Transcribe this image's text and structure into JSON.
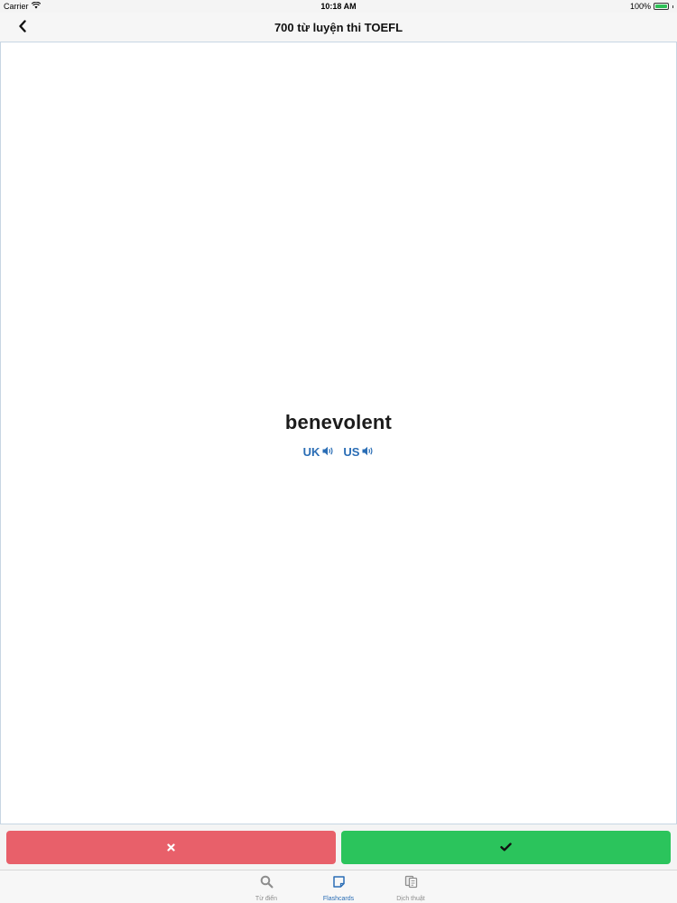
{
  "status_bar": {
    "carrier": "Carrier",
    "time": "10:18 AM",
    "battery": "100%",
    "battery_level": 1.0
  },
  "nav": {
    "title": "700 từ luyện thi TOEFL"
  },
  "card": {
    "word": "benevolent",
    "pronunciations": [
      {
        "label": "UK"
      },
      {
        "label": "US"
      }
    ]
  },
  "actions": {
    "wrong_color": "#e8606a",
    "right_color": "#2bc45c"
  },
  "tabs": [
    {
      "label": "Từ điển",
      "icon": "search-icon",
      "active": false
    },
    {
      "label": "Flashcards",
      "icon": "flashcard-icon",
      "active": true
    },
    {
      "label": "Dịch thuật",
      "icon": "translate-icon",
      "active": false
    }
  ],
  "colors": {
    "accent": "#2a6db5",
    "tab_inactive": "#8e8e8e"
  }
}
